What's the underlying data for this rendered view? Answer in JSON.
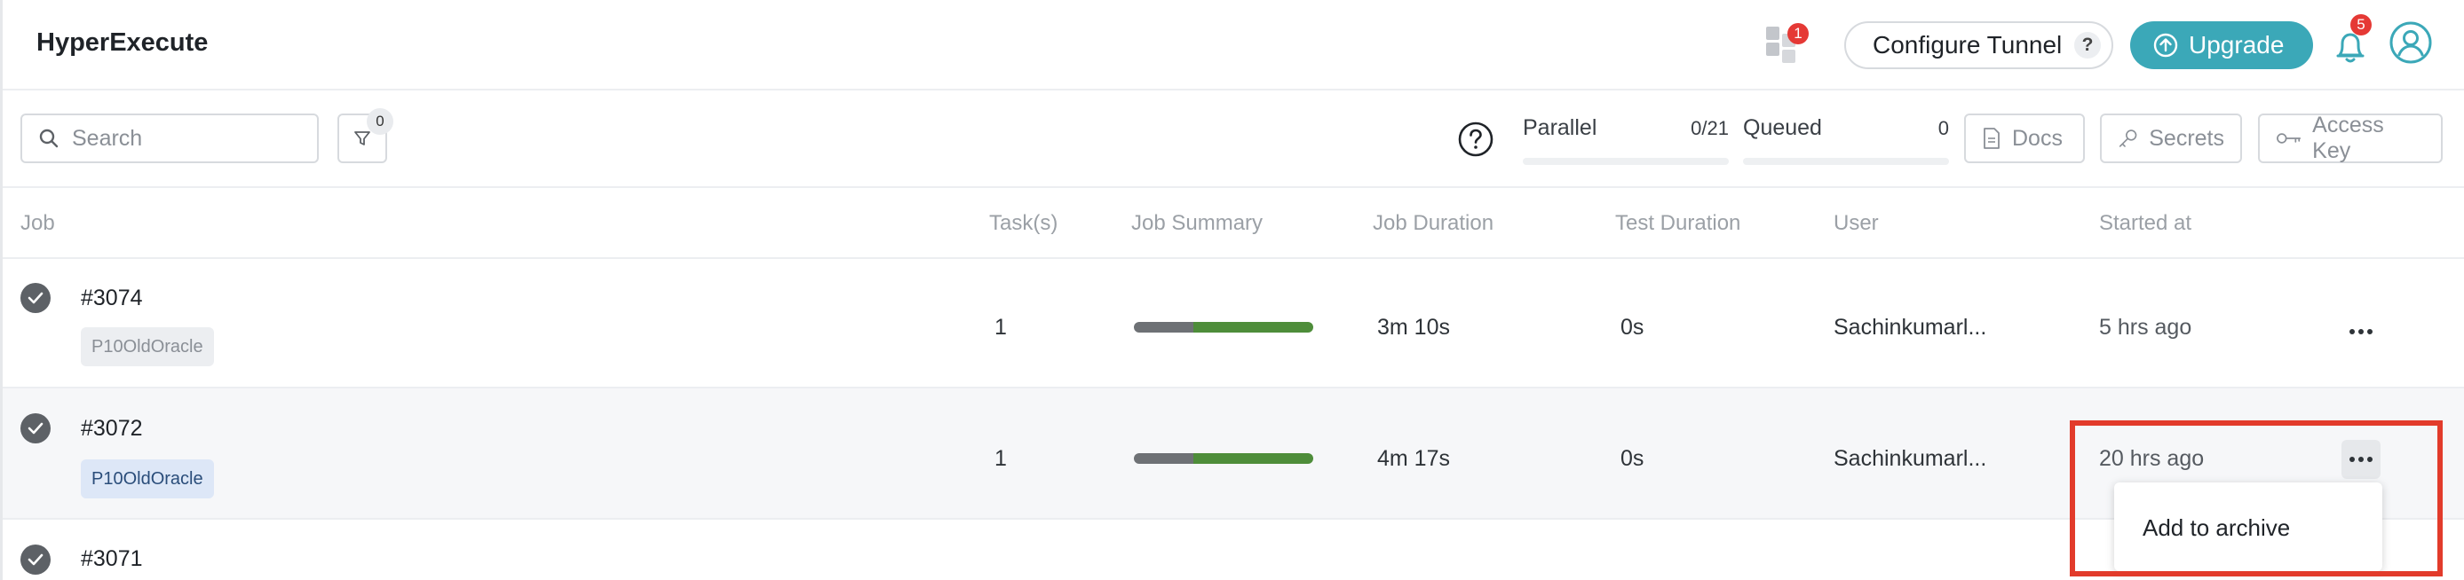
{
  "app": {
    "title": "HyperExecute"
  },
  "header": {
    "apps_badge": "1",
    "configure_tunnel_label": "Configure Tunnel",
    "configure_tunnel_help": "?",
    "upgrade_label": "Upgrade",
    "notifications_badge": "5"
  },
  "toolbar": {
    "search_placeholder": "Search",
    "filter_count": "0",
    "parallel": {
      "label": "Parallel",
      "value": "0/21"
    },
    "queued": {
      "label": "Queued",
      "value": "0"
    },
    "docs_label": "Docs",
    "secrets_label": "Secrets",
    "access_key_label": "Access Key"
  },
  "table": {
    "columns": [
      "Job",
      "Task(s)",
      "Job Summary",
      "Job Duration",
      "Test Duration",
      "User",
      "Started at"
    ],
    "rows": [
      {
        "job": "#3074",
        "tag": "P10OldOracle",
        "tasks": "1",
        "summary": {
          "gray": 0.33,
          "green": 0.67
        },
        "job_duration": "3m 10s",
        "test_duration": "0s",
        "user": "Sachinkumarl...",
        "started": "5 hrs ago"
      },
      {
        "job": "#3072",
        "tag": "P10OldOracle",
        "tasks": "1",
        "summary": {
          "gray": 0.33,
          "green": 0.67
        },
        "job_duration": "4m 17s",
        "test_duration": "0s",
        "user": "Sachinkumarl...",
        "started": "20 hrs ago"
      },
      {
        "job": "#3071"
      }
    ]
  },
  "menu": {
    "add_to_archive": "Add to archive"
  },
  "colors": {
    "accent": "#3ba8b8",
    "badge": "#e53935",
    "success": "#4e8d3a",
    "highlight": "#e23b2b"
  }
}
